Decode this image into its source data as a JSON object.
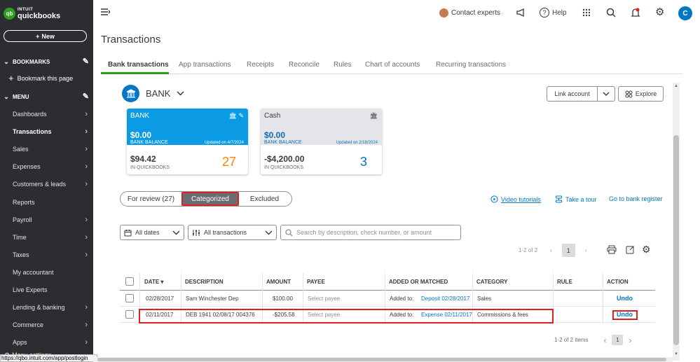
{
  "colors": {
    "brand_green": "#2ca01c",
    "sidebar_bg": "#2c2d30",
    "accent_blue": "#0077c5",
    "card_blue": "#0b9ae4",
    "highlight_red": "#e02020"
  },
  "sidebar": {
    "logo_top": "INTUIT",
    "logo_main": "quickbooks",
    "logo_mark": "qb",
    "new_label": "New",
    "bookmarks_label": "BOOKMARKS",
    "bookmark_this_page": "Bookmark this page",
    "menu_label": "MENU",
    "items": [
      {
        "label": "Dashboards",
        "arrow": true
      },
      {
        "label": "Transactions",
        "arrow": true
      },
      {
        "label": "Sales",
        "arrow": true
      },
      {
        "label": "Expenses",
        "arrow": true
      },
      {
        "label": "Customers & leads",
        "arrow": true
      },
      {
        "label": "Reports",
        "arrow": false
      },
      {
        "label": "Payroll",
        "arrow": true
      },
      {
        "label": "Time",
        "arrow": true
      },
      {
        "label": "Taxes",
        "arrow": true
      },
      {
        "label": "My accountant",
        "arrow": false
      },
      {
        "label": "Live Experts",
        "arrow": false
      },
      {
        "label": "Lending & banking",
        "arrow": true
      },
      {
        "label": "Commerce",
        "arrow": true
      },
      {
        "label": "Apps",
        "arrow": true
      }
    ],
    "menu_settings": "Menu settings",
    "status_url": "https://qbo.intuit.com/app/postlogin"
  },
  "topbar": {
    "contact_experts": "Contact experts",
    "help": "Help",
    "avatar_letter": "C"
  },
  "page_title": "Transactions",
  "tabs": [
    "Bank transactions",
    "App transactions",
    "Receipts",
    "Reconcile",
    "Rules",
    "Chart of accounts",
    "Recurring transactions"
  ],
  "bank": {
    "name": "BANK",
    "link_account": "Link account",
    "explore": "Explore"
  },
  "cards": [
    {
      "name": "BANK",
      "bank_balance": "$0.00",
      "bank_balance_label": "BANK BALANCE",
      "updated": "Updated on 4/7/2024",
      "qb_balance": "$94.42",
      "qb_label": "IN QUICKBOOKS",
      "count": "27"
    },
    {
      "name": "Cash",
      "bank_balance": "$0.00",
      "bank_balance_label": "BANK BALANCE",
      "updated": "Updated on 2/18/2024",
      "qb_balance": "-$4,200.00",
      "qb_label": "IN QUICKBOOKS",
      "count": "3"
    }
  ],
  "review_tabs": {
    "for_review": "For review (27)",
    "categorized": "Categorized",
    "excluded": "Excluded"
  },
  "links": {
    "video": "Video tutorials",
    "tour": "Take a tour",
    "register": "Go to bank register"
  },
  "filters": {
    "dates": "All dates",
    "transactions": "All transactions",
    "search_placeholder": "Search by description, check number, or amount"
  },
  "pager_top": {
    "range": "1-2 of 2",
    "page": "1"
  },
  "table": {
    "headers": {
      "date": "DATE",
      "description": "DESCRIPTION",
      "amount": "AMOUNT",
      "payee": "PAYEE",
      "added": "ADDED OR MATCHED",
      "category": "CATEGORY",
      "rule": "RULE",
      "action": "ACTION"
    },
    "rows": [
      {
        "date": "02/28/2017",
        "description": "Sam Winchester Dep",
        "amount": "$100.00",
        "payee": "Select payee",
        "added_prefix": "Added to:",
        "added_link": "Deposit 02/28/2017",
        "category": "Sales",
        "rule": "",
        "action": "Undo"
      },
      {
        "date": "02/11/2017",
        "description": "DEB 1941 02/08/17 004376",
        "amount": "-$205.58",
        "payee": "Select payee",
        "added_prefix": "Added to:",
        "added_link": "Expense 02/11/2017",
        "category": "Commissions & fees",
        "rule": "",
        "action": "Undo"
      }
    ]
  },
  "pager_bottom": {
    "range": "1-2 of 2 items",
    "page": "1"
  }
}
